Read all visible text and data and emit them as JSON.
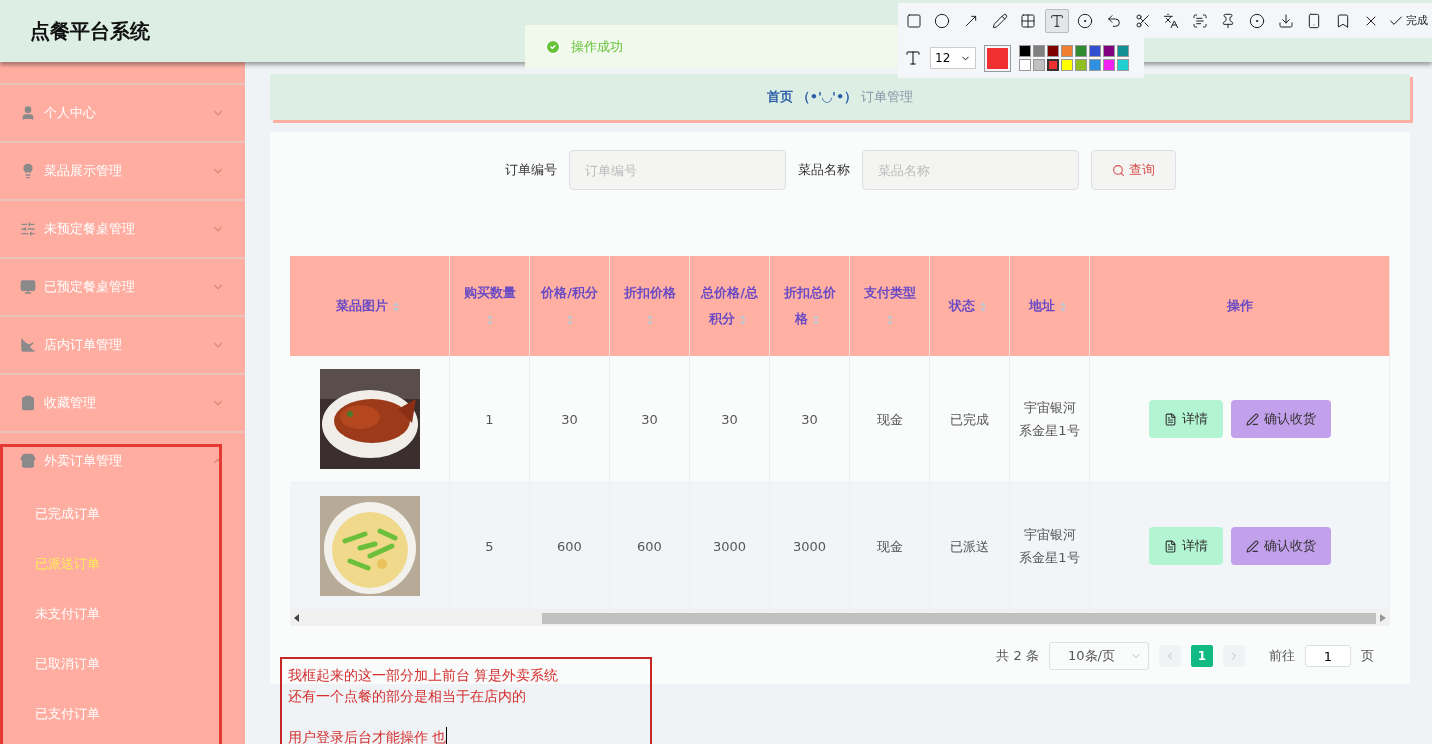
{
  "app_title": "点餐平台系统",
  "toast": {
    "message": "操作成功"
  },
  "annotation_toolbar": {
    "font_size": "12",
    "done_label": "完成",
    "palette": [
      {
        "color": "#000000",
        "selected": false
      },
      {
        "color": "#808080",
        "selected": false
      },
      {
        "color": "#800000",
        "selected": false
      },
      {
        "color": "#f08030",
        "selected": false
      },
      {
        "color": "#2e8b2e",
        "selected": false
      },
      {
        "color": "#3050d0",
        "selected": false
      },
      {
        "color": "#800080",
        "selected": false
      },
      {
        "color": "#109090",
        "selected": false
      },
      {
        "color": "#ffffff",
        "selected": false
      },
      {
        "color": "#c0c0c0",
        "selected": false
      },
      {
        "color": "#f03030",
        "selected": true
      },
      {
        "color": "#ffff00",
        "selected": false
      },
      {
        "color": "#90c020",
        "selected": false
      },
      {
        "color": "#3090e0",
        "selected": false
      },
      {
        "color": "#f020f0",
        "selected": false
      },
      {
        "color": "#20d0d0",
        "selected": false
      }
    ]
  },
  "sidebar": {
    "items": [
      {
        "label": "个人中心",
        "expanded": false
      },
      {
        "label": "菜品展示管理",
        "expanded": false
      },
      {
        "label": "未预定餐桌管理",
        "expanded": false
      },
      {
        "label": "已预定餐桌管理",
        "expanded": false
      },
      {
        "label": "店内订单管理",
        "expanded": false
      },
      {
        "label": "收藏管理",
        "expanded": false
      },
      {
        "label": "外卖订单管理",
        "expanded": true,
        "children": [
          {
            "label": "已完成订单",
            "selected": false
          },
          {
            "label": "已派送订单",
            "selected": true
          },
          {
            "label": "未支付订单",
            "selected": false
          },
          {
            "label": "已取消订单",
            "selected": false
          },
          {
            "label": "已支付订单",
            "selected": false
          }
        ]
      }
    ]
  },
  "breadcrumb": {
    "home": "首页",
    "separator": "（•'◡'•）",
    "current": "订单管理"
  },
  "search": {
    "fields": [
      {
        "label": "订单编号",
        "placeholder": "订单编号"
      },
      {
        "label": "菜品名称",
        "placeholder": "菜品名称"
      }
    ],
    "button": "查询"
  },
  "table": {
    "columns": [
      {
        "label": "菜品图片",
        "sortable": true
      },
      {
        "label": "购买数量",
        "sortable": true
      },
      {
        "label": "价格/积分",
        "sortable": true
      },
      {
        "label": "折扣价格",
        "sortable": true
      },
      {
        "label": "总价格/总积分",
        "sortable": true
      },
      {
        "label": "折扣总价格",
        "sortable": true
      },
      {
        "label": "支付类型",
        "sortable": true
      },
      {
        "label": "状态",
        "sortable": true
      },
      {
        "label": "地址",
        "sortable": true
      },
      {
        "label": "操作",
        "sortable": false
      }
    ],
    "rows": [
      {
        "cells": [
          {
            "kind": "picture"
          },
          "1",
          "30",
          "30",
          "30",
          "30",
          "现金",
          "已完成",
          "宇宙银河系金星1号",
          {
            "actions": [
              {
                "kind": "detail",
                "label": "详情"
              },
              {
                "kind": "confirm",
                "label": "确认收货"
              }
            ]
          }
        ]
      },
      {
        "cells": [
          {
            "kind": "picture"
          },
          "5",
          "600",
          "600",
          "3000",
          "3000",
          "现金",
          "已派送",
          "宇宙银河系金星1号",
          {
            "actions": [
              {
                "kind": "detail",
                "label": "详情"
              },
              {
                "kind": "confirm",
                "label": "确认收货"
              }
            ]
          }
        ]
      }
    ]
  },
  "pagination": {
    "total": "共 2 条",
    "page_size": "10条/页",
    "pages": [
      {
        "label": "1",
        "selected": true
      }
    ],
    "goto_label": "前往",
    "goto_value": "1",
    "page_suffix": "页"
  },
  "annotation": {
    "paragraphs": [
      {
        "lines": [
          "我框起来的这一部分加上前台 算是外卖系统",
          "还有一个点餐的部分是相当于在店内的"
        ]
      },
      {
        "lines": [
          "用户登录后台才能操作 也"
        ]
      }
    ]
  }
}
